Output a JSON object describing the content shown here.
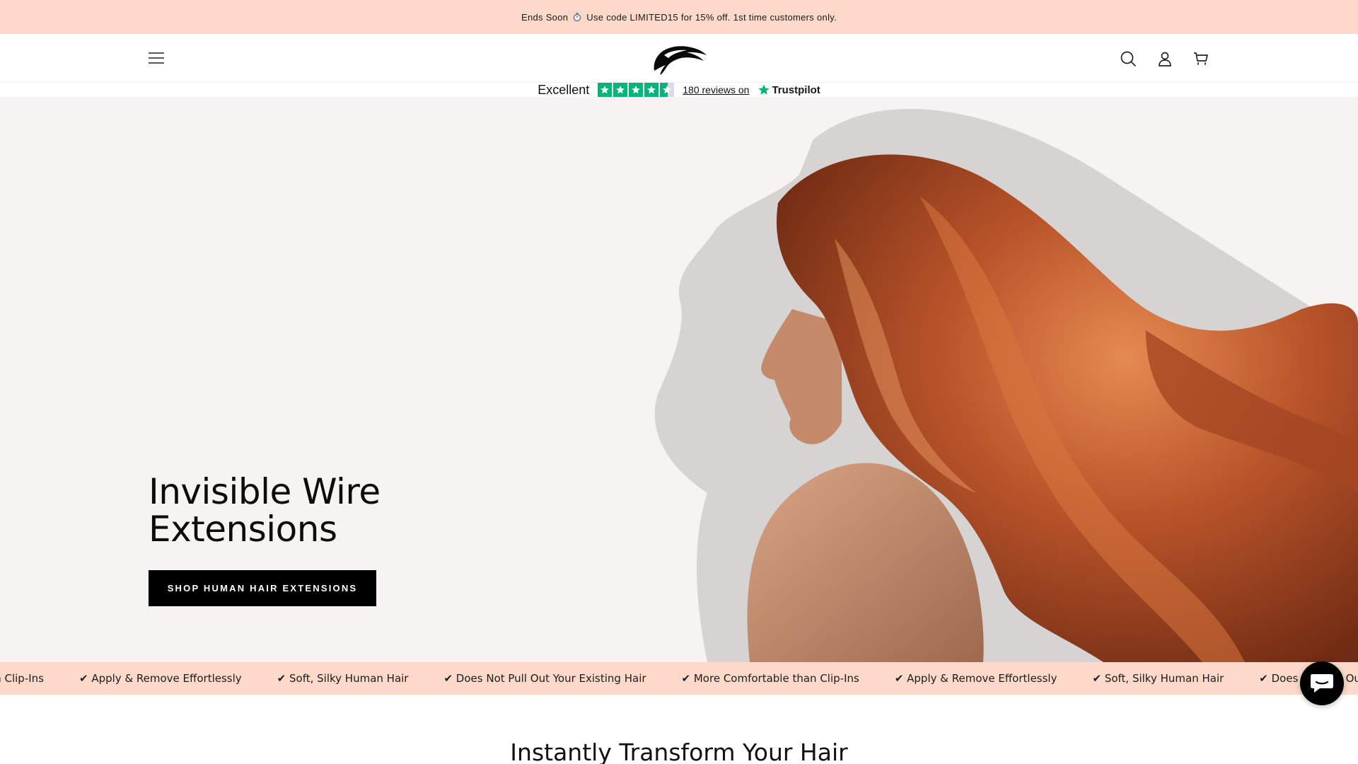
{
  "announcement": {
    "text_before": "Ends Soon",
    "timer_icon": "stopwatch-icon",
    "text_after": "Use code LIMITED15 for 15% off. 1st time customers only."
  },
  "header": {
    "menu_icon": "hamburger-menu-icon",
    "logo": "horse-mane-logo",
    "search_icon": "search-icon",
    "account_icon": "account-icon",
    "cart_icon": "cart-icon"
  },
  "trustpilot": {
    "rating_label": "Excellent",
    "stars_rating": 4.5,
    "reviews_text": "180 reviews on",
    "brand": "Trustpilot",
    "colors": {
      "star": "#00b67a",
      "empty_star": "#dcdce6"
    }
  },
  "hero": {
    "title_line1": "Invisible Wire",
    "title_line2": "Extensions",
    "cta_label": "SHOP HUMAN HAIR EXTENSIONS",
    "image": "woman-with-long-red-wavy-hair"
  },
  "marquee": {
    "items": [
      "Comfortable than Clip-Ins",
      "✔ Apply & Remove Effortlessly",
      "✔ Soft, Silky Human Hair",
      "✔ Does Not Pull Out Your Existing Hair",
      "✔ More Comfortable than Clip-Ins",
      "✔ Apply & Remove Effortlessly",
      "✔ Soft, Silky Human Hair",
      "✔ Does Not Pull Out Your Existing Hair"
    ]
  },
  "section": {
    "heading": "Instantly Transform Your Hair"
  },
  "chat": {
    "icon": "chat-bubble-icon"
  },
  "colors": {
    "accent_peach": "#fcd9c8",
    "hero_background": "#f7f3f0",
    "button_black": "#000000"
  }
}
